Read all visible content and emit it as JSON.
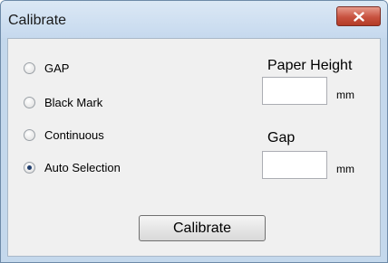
{
  "window": {
    "title": "Calibrate"
  },
  "media_type": {
    "options": [
      "GAP",
      "Black Mark",
      "Continuous",
      "Auto Selection"
    ],
    "selected": "Auto Selection"
  },
  "paper_height": {
    "label": "Paper Height",
    "value": "",
    "unit": "mm"
  },
  "gap": {
    "label": "Gap",
    "value": "",
    "unit": "mm"
  },
  "buttons": {
    "calibrate_label": "Calibrate"
  },
  "icons": {
    "close": "close-icon"
  }
}
